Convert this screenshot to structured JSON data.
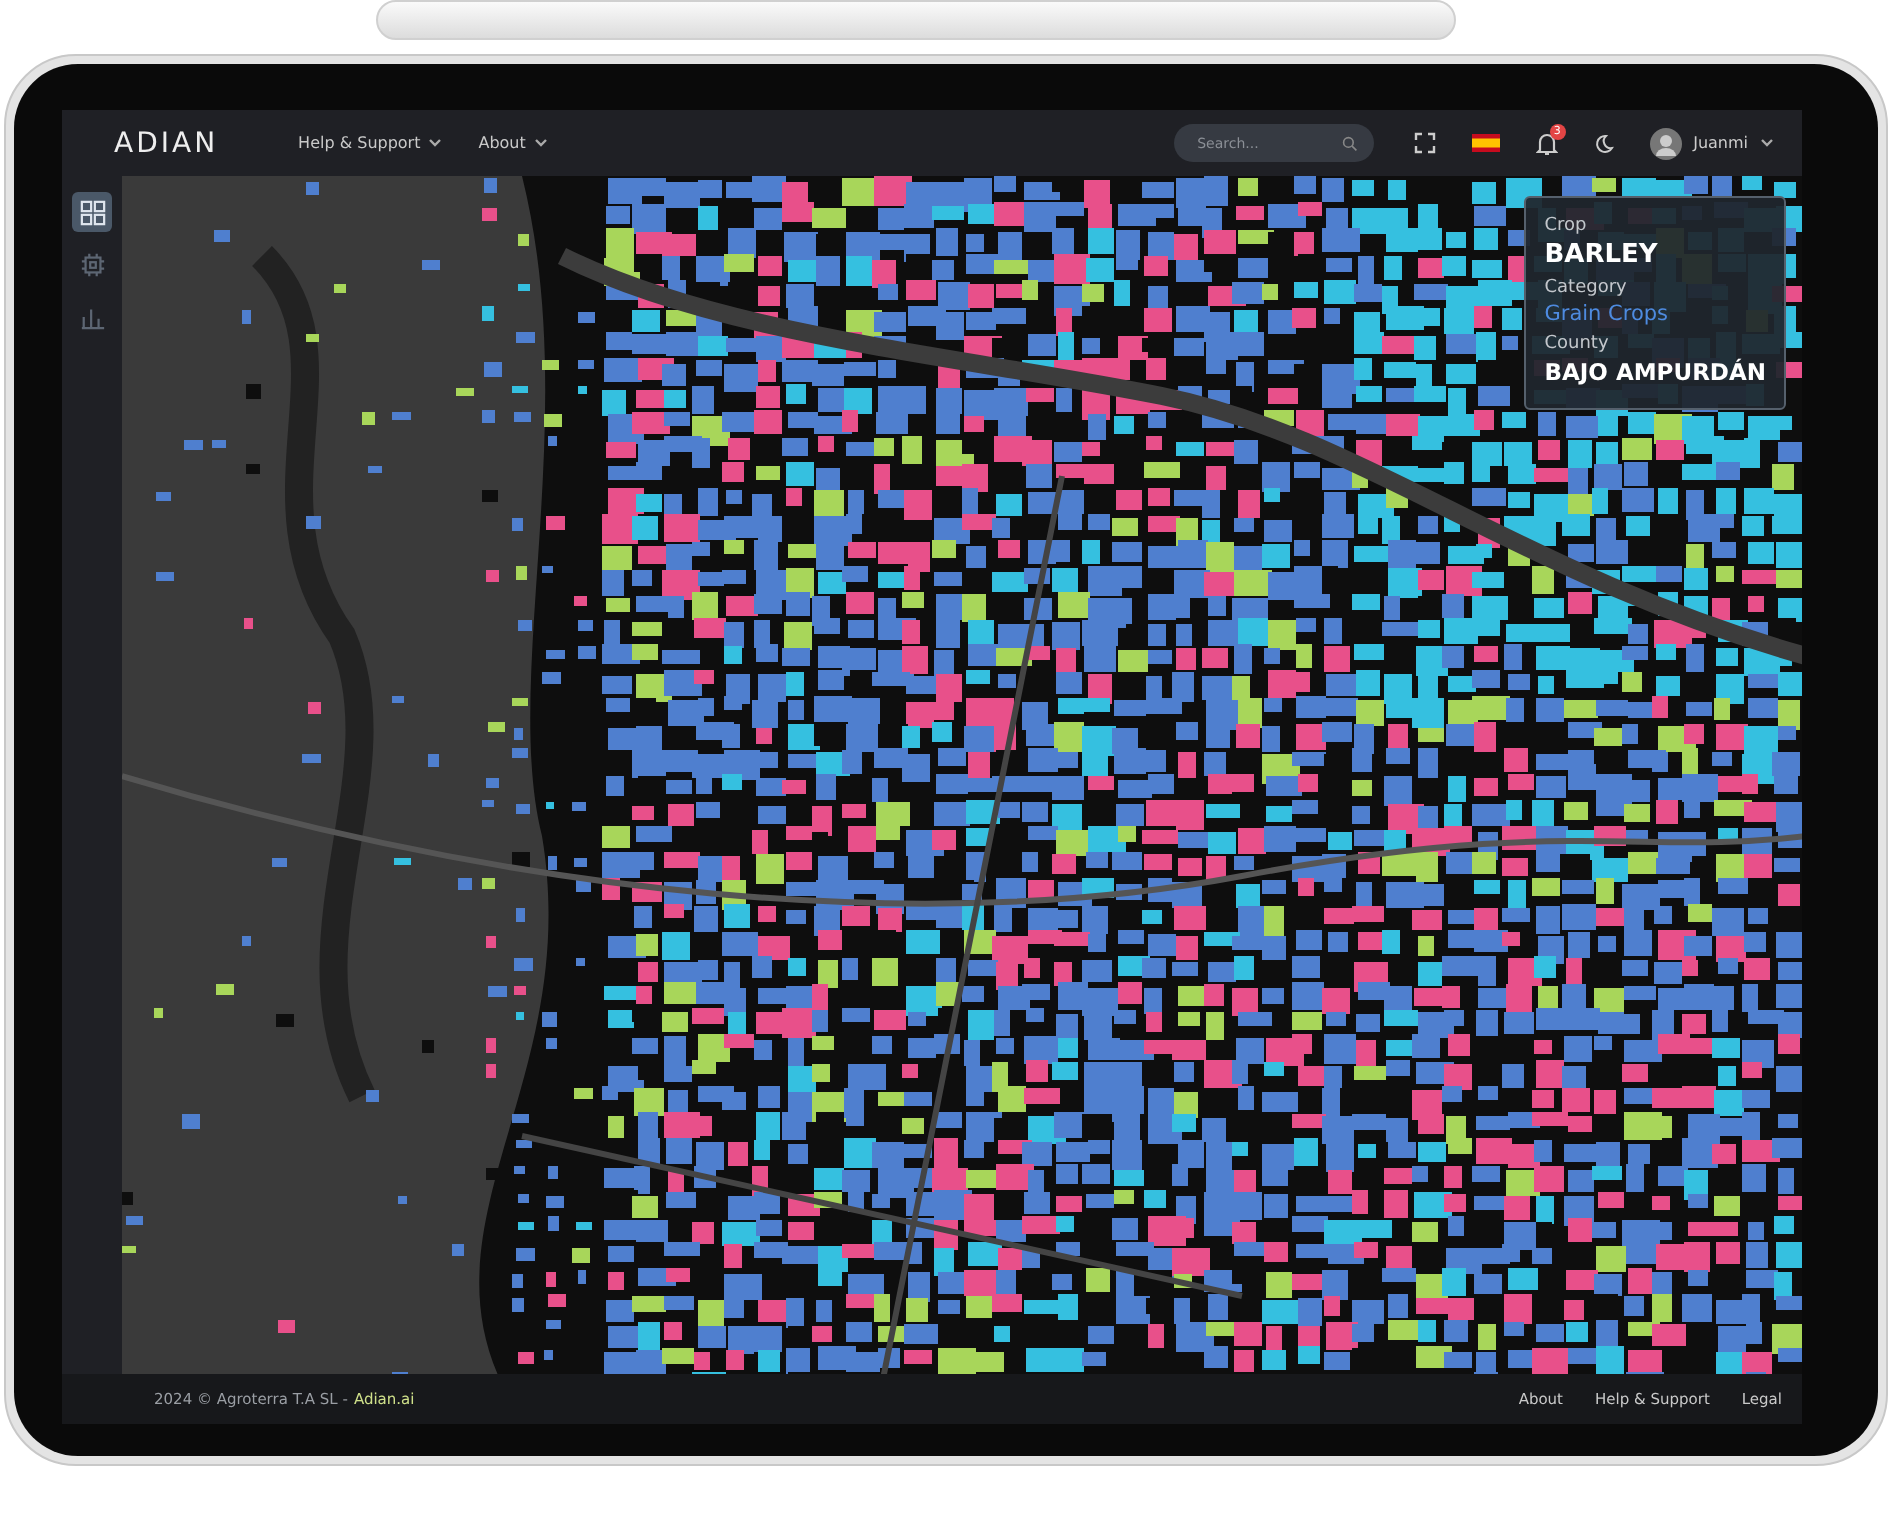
{
  "header": {
    "logo": "ADIAN",
    "nav": [
      {
        "label": "Help & Support"
      },
      {
        "label": "About"
      }
    ],
    "search": {
      "placeholder": "Search..."
    },
    "notifications": {
      "badge": "3"
    },
    "user": {
      "name": "Juanmi"
    }
  },
  "sidebar": {
    "items": [
      {
        "kind": "dashboard",
        "selected": true
      },
      {
        "kind": "chip",
        "selected": false
      },
      {
        "kind": "chart",
        "selected": false
      }
    ]
  },
  "popup": {
    "fields": [
      {
        "label": "Crop",
        "value": "BARLEY",
        "kind": "plain"
      },
      {
        "label": "Category",
        "value": "Grain Crops",
        "kind": "accent"
      },
      {
        "label": "County",
        "value": "BAJO AMPURDÁN",
        "kind": "plain"
      }
    ]
  },
  "footer": {
    "copyright": "2024 © Agroterra T.A SL -",
    "brand": "Adian.ai",
    "links": [
      "About",
      "Help & Support",
      "Legal"
    ]
  }
}
